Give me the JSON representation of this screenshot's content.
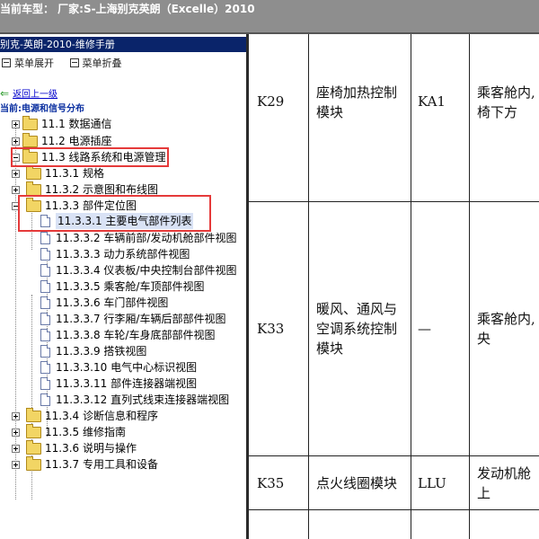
{
  "header": {
    "title": "当前车型：  厂家:S-上海别克英朗（Excelle）2010"
  },
  "tree_panel": {
    "title": "别克-英朗-2010-维修手册",
    "toolbar": {
      "expand_label": "菜单展开",
      "collapse_label": "菜单折叠"
    },
    "back_link": "返回上一级",
    "current_location": "当前:电源和信号分布",
    "items": [
      {
        "label": "11.1 数据通信"
      },
      {
        "label": "11.2 电源插座"
      },
      {
        "label": "11.3 线路系统和电源管理"
      },
      {
        "label": "11.3.1 规格"
      },
      {
        "label": "11.3.2 示意图和布线图"
      },
      {
        "label": "11.3.3 部件定位图"
      },
      {
        "label": "11.3.3.1 主要电气部件列表"
      },
      {
        "label": "11.3.3.2 车辆前部/发动机舱部件视图"
      },
      {
        "label": "11.3.3.3 动力系统部件视图"
      },
      {
        "label": "11.3.3.4 仪表板/中央控制台部件视图"
      },
      {
        "label": "11.3.3.5 乘客舱/车顶部件视图"
      },
      {
        "label": "11.3.3.6 车门部件视图"
      },
      {
        "label": "11.3.3.7 行李厢/车辆后部部件视图"
      },
      {
        "label": "11.3.3.8 车轮/车身底部部件视图"
      },
      {
        "label": "11.3.3.9 搭铁视图"
      },
      {
        "label": "11.3.3.10 电气中心标识视图"
      },
      {
        "label": "11.3.3.11 部件连接器端视图"
      },
      {
        "label": "11.3.3.12 直列式线束连接器端视图"
      },
      {
        "label": "11.3.4 诊断信息和程序"
      },
      {
        "label": "11.3.5 维修指南"
      },
      {
        "label": "11.3.6 说明与操作"
      },
      {
        "label": "11.3.7 专用工具和设备"
      }
    ]
  },
  "table": {
    "rows": [
      {
        "code": "K29",
        "name": "座椅加热控制\n模块",
        "abbr": "KA1",
        "location": "乘客舱内,\n椅下方"
      },
      {
        "code": "K33",
        "name": "暖风、通风与\n空调系统控制\n模块",
        "abbr": "—",
        "location": "乘客舱内,\n央"
      },
      {
        "code": "K35",
        "name": "点火线圈模块",
        "abbr": "LLU",
        "location": "发动机舱\n上"
      }
    ]
  },
  "colors": {
    "highlight_box": "#e53a3a",
    "panel_title_bg": "#0a246a",
    "selected_bg": "#d9e2f5"
  }
}
